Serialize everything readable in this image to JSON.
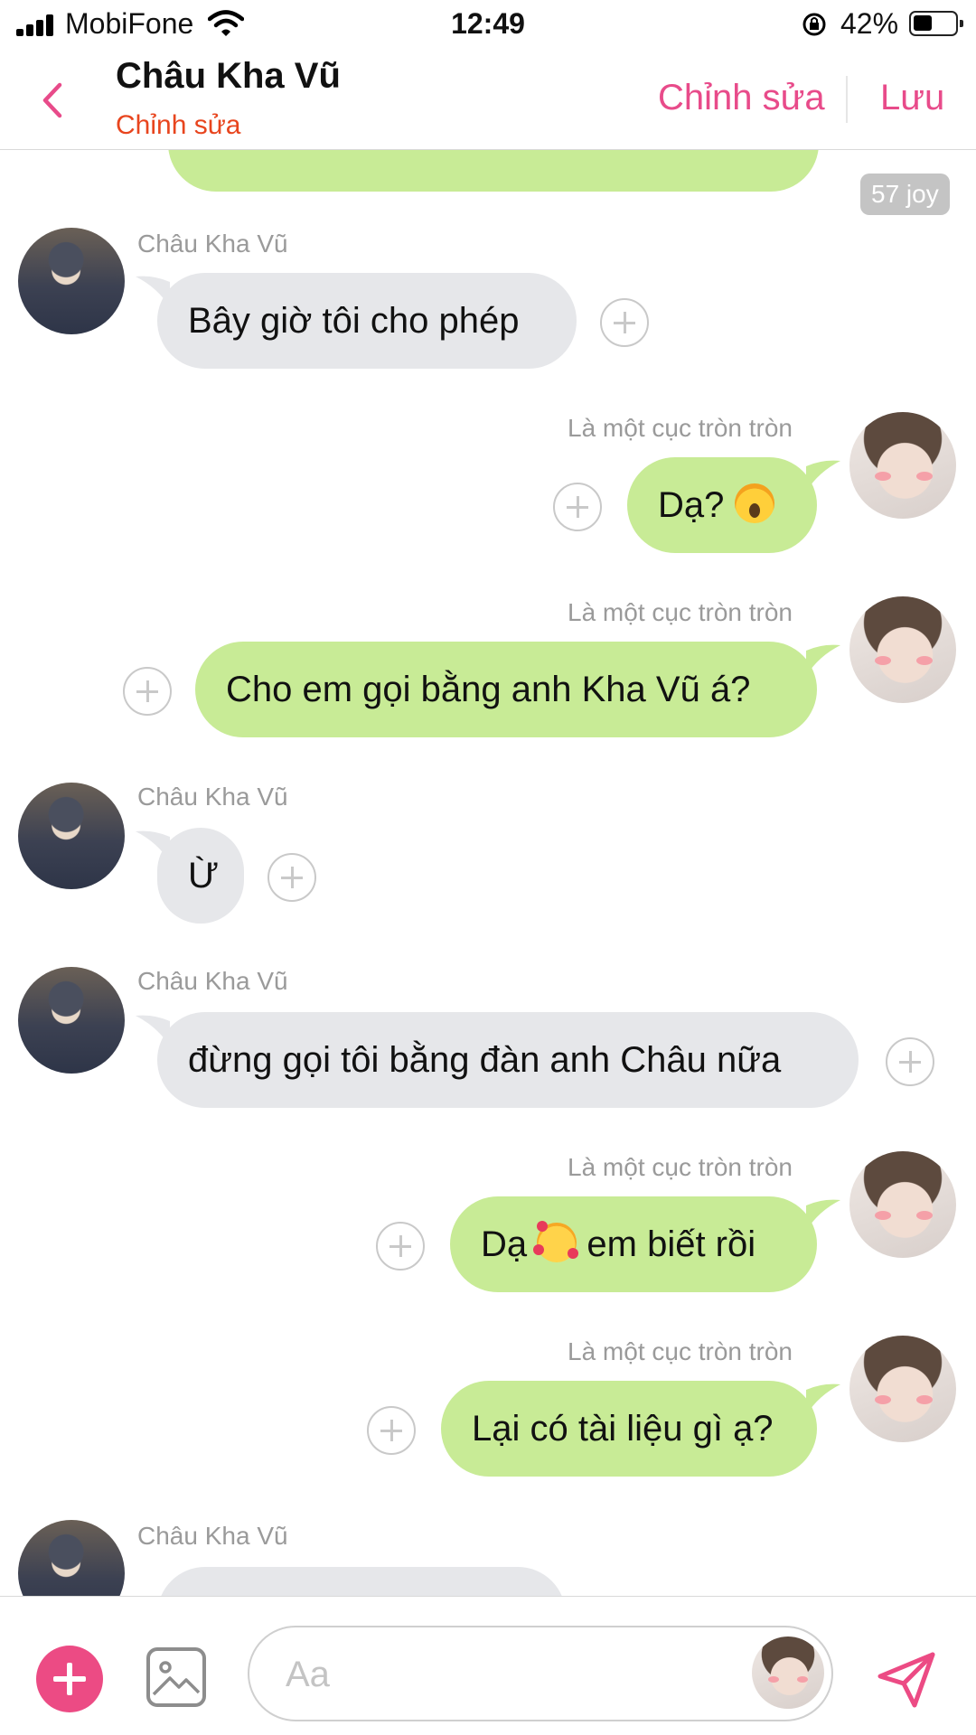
{
  "status_bar": {
    "carrier": "MobiFone",
    "time": "12:49",
    "battery": "42%"
  },
  "header": {
    "title": "Châu Kha Vũ",
    "subtitle": "Chỉnh sửa",
    "edit_label": "Chỉnh sửa",
    "save_label": "Lưu"
  },
  "colors": {
    "accent": "#e84b8a",
    "subtitle": "#e8451e",
    "bubble_green": "#c8eb96",
    "bubble_gray": "#e6e7ea"
  },
  "chat": {
    "badge": "57 joy",
    "messages": [
      {
        "side": "left",
        "sender": "Châu Kha Vũ",
        "text": "Bây giờ tôi cho phép"
      },
      {
        "side": "right",
        "sender": "Là một cục tròn tròn",
        "text": "Dạ?",
        "emoji": "face-screaming-in-fear"
      },
      {
        "side": "right",
        "sender": "Là một cục tròn tròn",
        "text": "Cho em gọi bằng anh Kha Vũ á?"
      },
      {
        "side": "left",
        "sender": "Châu Kha Vũ",
        "text": "Ừ"
      },
      {
        "side": "left",
        "sender": "Châu Kha Vũ",
        "text": "đừng gọi tôi bằng đàn anh Châu nữa"
      },
      {
        "side": "right",
        "sender": "Là một cục tròn tròn",
        "text_before": "Dạ",
        "emoji": "smiling-face-with-hearts",
        "text_after": "em biết rồi"
      },
      {
        "side": "right",
        "sender": "Là một cục tròn tròn",
        "text": "Lại có tài liệu gì ạ?"
      },
      {
        "side": "left",
        "sender": "Châu Kha Vũ",
        "text": ""
      }
    ]
  },
  "composer": {
    "placeholder": "Aa",
    "icons": [
      "add-icon",
      "image-icon",
      "send-icon"
    ]
  }
}
